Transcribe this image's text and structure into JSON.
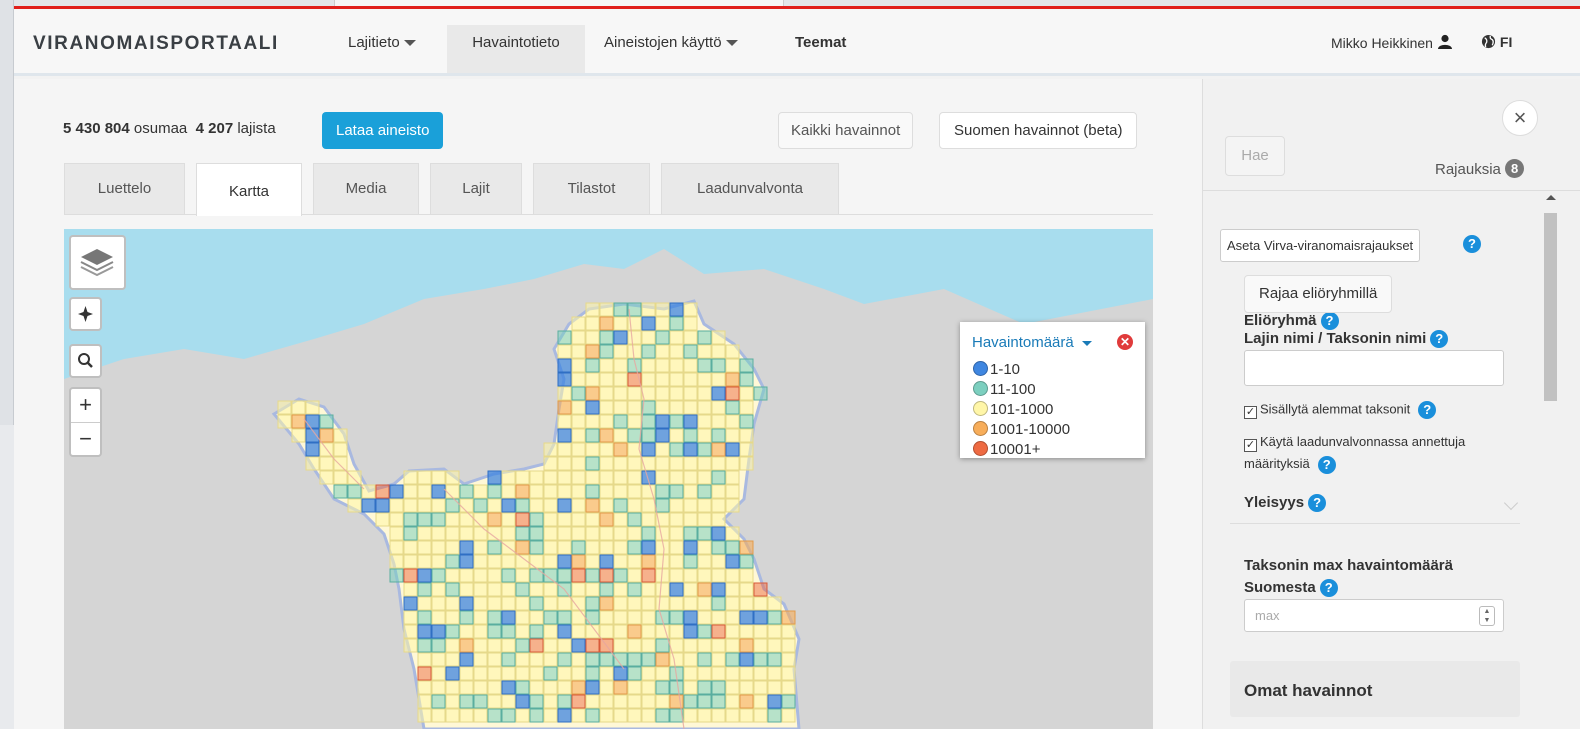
{
  "navbar": {
    "brand": "VIRANOMAISPORTAALI",
    "items": [
      {
        "label": "Lajitieto",
        "dropdown": true
      },
      {
        "label": "Havaintotieto",
        "active": true
      },
      {
        "label": "Aineistojen käyttö",
        "dropdown": true
      },
      {
        "label": "Teemat"
      }
    ],
    "user": "Mikko Heikkinen",
    "lang": "FI"
  },
  "summary": {
    "hits_count": "5 430 804",
    "hits_label": "osumaa",
    "species_count": "4 207",
    "species_label": "lajista",
    "download_label": "Lataa aineisto",
    "all_obs_label": "Kaikki havainnot",
    "finnish_obs_label": "Suomen havainnot (beta)"
  },
  "tabs": [
    {
      "label": "Luettelo"
    },
    {
      "label": "Kartta",
      "active": true
    },
    {
      "label": "Media"
    },
    {
      "label": "Lajit"
    },
    {
      "label": "Tilastot"
    },
    {
      "label": "Laadunvalvonta"
    }
  ],
  "map": {
    "zoom_in": "+",
    "zoom_out": "−",
    "legend": {
      "title": "Havaintomäärä",
      "classes": [
        {
          "label": "1-10",
          "color": "#3f86e0"
        },
        {
          "label": "11-100",
          "color": "#7ccfbf"
        },
        {
          "label": "101-1000",
          "color": "#fff6a8"
        },
        {
          "label": "1001-10000",
          "color": "#f7ad5a"
        },
        {
          "label": "10001+",
          "color": "#ee6a42"
        }
      ]
    }
  },
  "sidebar": {
    "search_label": "Hae",
    "filters_label": "Rajauksia",
    "filters_count": "8",
    "virva_label": "Aseta Virva-viranomaisrajaukset",
    "org_group_title": "Eliöryhmä",
    "org_group_button": "Rajaa eliöryhmillä",
    "taxon_title": "Lajin nimi / Taksonin nimi",
    "taxon_value": "",
    "include_lower": "Sisällytä alemmat taksonit",
    "use_qc_line1": "Käytä laadunvalvonnassa annettuja",
    "use_qc_line2": "määrityksiä",
    "generality_title": "Yleisyys",
    "max_title_line1": "Taksonin max havaintomäärä",
    "max_title_line2": "Suomesta",
    "max_placeholder": "max",
    "own_obs_title": "Omat havainnot"
  }
}
